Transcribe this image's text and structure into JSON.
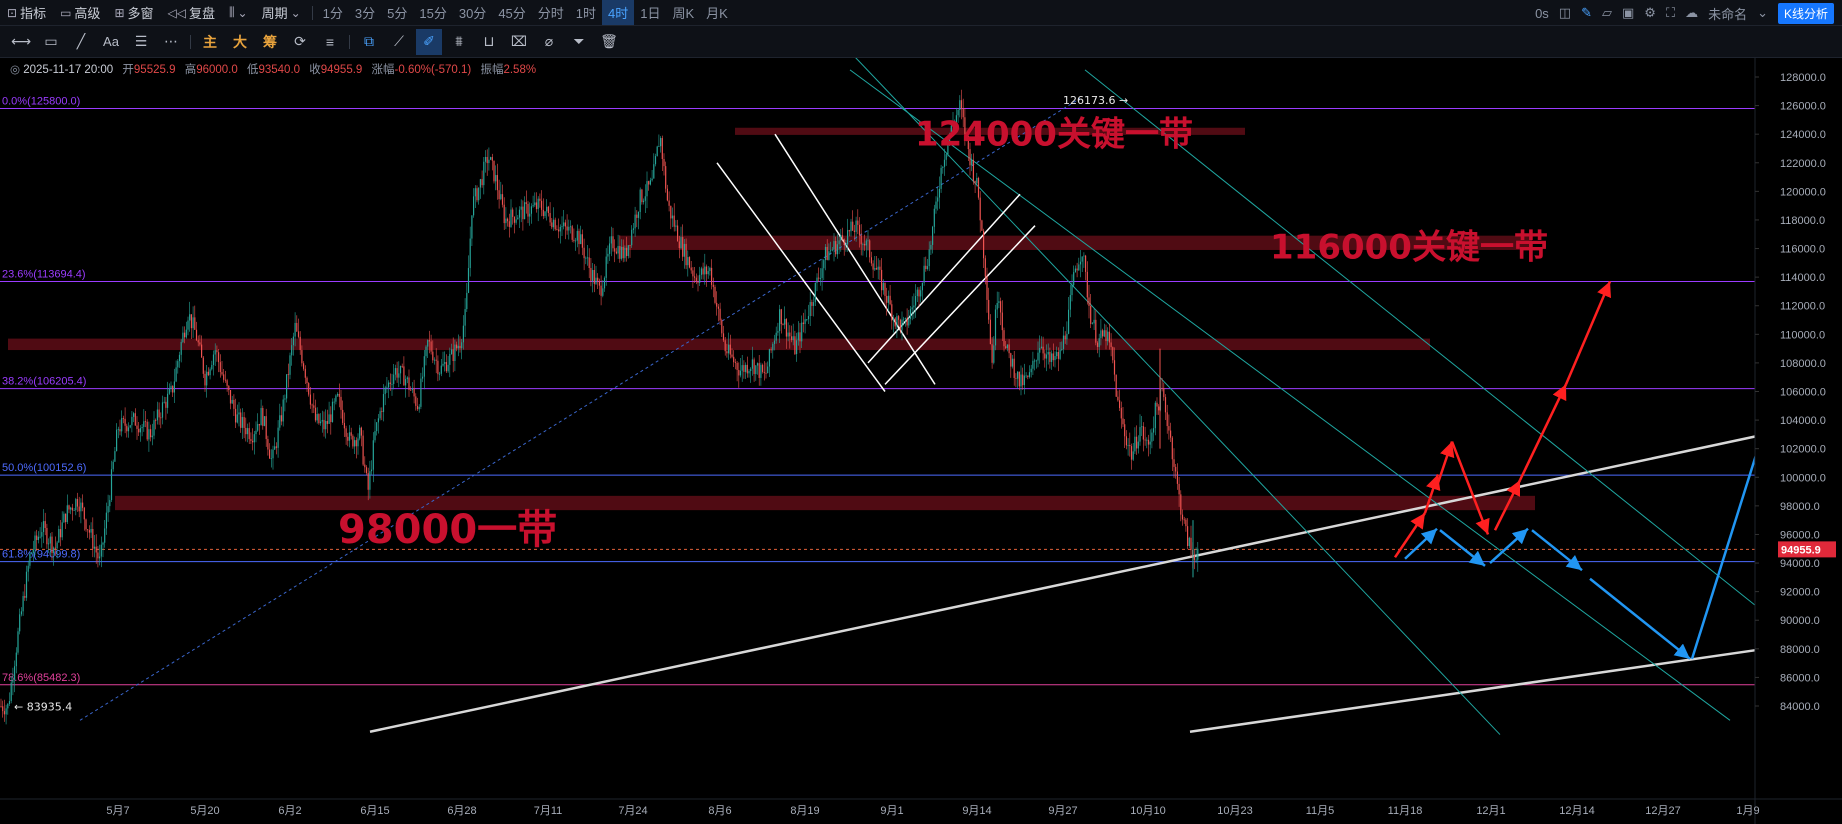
{
  "toolbar_top": {
    "left": [
      {
        "icon": "indicator-icon",
        "label": "指标"
      },
      {
        "icon": "advanced-icon",
        "label": "高级"
      },
      {
        "icon": "multiwindow-icon",
        "label": "多窗"
      },
      {
        "icon": "replay-icon",
        "label": "复盘"
      },
      {
        "icon": "candle-type-icon",
        "label": ""
      },
      {
        "icon": "",
        "label": "周期"
      }
    ],
    "periods": [
      "1分",
      "3分",
      "5分",
      "15分",
      "30分",
      "45分",
      "分时",
      "1时",
      "4时",
      "1日",
      "周K",
      "月K"
    ],
    "active_period": "4时",
    "right": {
      "timer": "0s",
      "layout_name": "未命名",
      "analysis_button": "K线分析"
    }
  },
  "toolbar_draw": {
    "labels": [
      "主",
      "大",
      "筹"
    ]
  },
  "info_bar": {
    "datetime": "2025-11-17 20:00",
    "open_label": "开",
    "open": "95525.9",
    "high_label": "高",
    "high": "96000.0",
    "low_label": "低",
    "low": "93540.0",
    "close_label": "收",
    "close": "94955.9",
    "change_label": "涨幅",
    "change": "-0.60%(-570.1)",
    "amplitude_label": "振幅",
    "amplitude": "2.58%"
  },
  "colors": {
    "background": "#000000",
    "fib_purple": "#9b3cff",
    "fib_blue": "#4d6bff",
    "fib_magenta": "#e0409a",
    "zone": "#6b0f1a",
    "bull": "#26a69a",
    "bear": "#ef5350",
    "annotation_red": "#c8102e",
    "arrow_red": "#ff2020",
    "arrow_blue": "#2196f3",
    "current_price_bg": "#e0293a"
  },
  "chart_data": {
    "type": "candlestick",
    "y_ticks": [
      84000,
      86000,
      88000,
      90000,
      92000,
      94000,
      96000,
      98000,
      100000,
      102000,
      104000,
      106000,
      108000,
      110000,
      112000,
      114000,
      116000,
      118000,
      120000,
      122000,
      124000,
      126000,
      128000
    ],
    "y_tick_labels": [
      "84000.0",
      "86000.0",
      "88000.0",
      "90000.0",
      "92000.0",
      "94000.0",
      "96000.0",
      "98000.0",
      "100000.0",
      "102000.0",
      "104000.0",
      "106000.0",
      "108000.0",
      "110000.0",
      "112000.0",
      "114000.0",
      "116000.0",
      "118000.0",
      "120000.0",
      "122000.0",
      "124000.0",
      "126000.0",
      "128000.0"
    ],
    "ylim": [
      82000,
      129500
    ],
    "x_tick_labels": [
      "5月7",
      "5月20",
      "6月2",
      "6月15",
      "6月28",
      "7月11",
      "7月24",
      "8月6",
      "8月19",
      "9月1",
      "9月14",
      "9月27",
      "10月10",
      "10月23",
      "11月5",
      "11月18",
      "12月1",
      "12月14",
      "12月27",
      "1月9"
    ],
    "price_path": [
      [
        0,
        84000
      ],
      [
        8,
        83935
      ],
      [
        18,
        89000
      ],
      [
        30,
        94500
      ],
      [
        42,
        96500
      ],
      [
        55,
        95000
      ],
      [
        66,
        97500
      ],
      [
        78,
        98500
      ],
      [
        88,
        96500
      ],
      [
        100,
        94000
      ],
      [
        108,
        98000
      ],
      [
        118,
        103500
      ],
      [
        135,
        104000
      ],
      [
        150,
        103000
      ],
      [
        163,
        105000
      ],
      [
        172,
        106000
      ],
      [
        180,
        109000
      ],
      [
        188,
        111500
      ],
      [
        196,
        110000
      ],
      [
        205,
        107000
      ],
      [
        215,
        109000
      ],
      [
        225,
        106500
      ],
      [
        238,
        104000
      ],
      [
        252,
        103000
      ],
      [
        262,
        104500
      ],
      [
        272,
        101000
      ],
      [
        282,
        104500
      ],
      [
        295,
        110500
      ],
      [
        305,
        107500
      ],
      [
        315,
        104000
      ],
      [
        325,
        103500
      ],
      [
        338,
        105500
      ],
      [
        350,
        102500
      ],
      [
        360,
        103000
      ],
      [
        368,
        99000
      ],
      [
        375,
        103000
      ],
      [
        385,
        106000
      ],
      [
        395,
        107500
      ],
      [
        405,
        107000
      ],
      [
        418,
        105000
      ],
      [
        428,
        109500
      ],
      [
        440,
        107500
      ],
      [
        452,
        108500
      ],
      [
        460,
        109500
      ],
      [
        466,
        111500
      ],
      [
        472,
        119000
      ],
      [
        480,
        120500
      ],
      [
        488,
        122500
      ],
      [
        495,
        121000
      ],
      [
        505,
        118000
      ],
      [
        520,
        118500
      ],
      [
        540,
        119000
      ],
      [
        560,
        117500
      ],
      [
        578,
        117000
      ],
      [
        590,
        114500
      ],
      [
        600,
        113000
      ],
      [
        612,
        116500
      ],
      [
        625,
        115500
      ],
      [
        640,
        119500
      ],
      [
        652,
        120500
      ],
      [
        660,
        124000
      ],
      [
        668,
        119000
      ],
      [
        680,
        116500
      ],
      [
        695,
        114000
      ],
      [
        710,
        114500
      ],
      [
        725,
        109000
      ],
      [
        740,
        107500
      ],
      [
        752,
        108000
      ],
      [
        765,
        107000
      ],
      [
        780,
        111500
      ],
      [
        795,
        109000
      ],
      [
        810,
        112000
      ],
      [
        825,
        115500
      ],
      [
        840,
        116500
      ],
      [
        855,
        117500
      ],
      [
        868,
        116000
      ],
      [
        882,
        113500
      ],
      [
        895,
        111000
      ],
      [
        905,
        110500
      ],
      [
        918,
        113000
      ],
      [
        930,
        116000
      ],
      [
        942,
        122000
      ],
      [
        952,
        124500
      ],
      [
        960,
        126000
      ],
      [
        968,
        123000
      ],
      [
        978,
        120000
      ],
      [
        986,
        114000
      ],
      [
        992,
        108000
      ],
      [
        998,
        113500
      ],
      [
        1005,
        109000
      ],
      [
        1012,
        108000
      ],
      [
        1020,
        106500
      ],
      [
        1030,
        107000
      ],
      [
        1040,
        109500
      ],
      [
        1050,
        108000
      ],
      [
        1060,
        108500
      ],
      [
        1068,
        111000
      ],
      [
        1075,
        114500
      ],
      [
        1082,
        116000
      ],
      [
        1090,
        111500
      ],
      [
        1098,
        109500
      ],
      [
        1106,
        110000
      ],
      [
        1112,
        108500
      ],
      [
        1118,
        105000
      ],
      [
        1125,
        103000
      ],
      [
        1132,
        101500
      ],
      [
        1140,
        103500
      ],
      [
        1148,
        102000
      ],
      [
        1155,
        104500
      ],
      [
        1162,
        106000
      ],
      [
        1170,
        103000
      ],
      [
        1178,
        99000
      ],
      [
        1186,
        96000
      ],
      [
        1193,
        94500
      ],
      [
        1198,
        95000
      ]
    ],
    "annotations": {
      "key_124000": "124000关键一带",
      "key_116000": "116000关键一带",
      "key_98000": "98000一带",
      "high_label": "126173.6",
      "low_label": "83935.4",
      "current_price": "94955.9"
    },
    "fib_levels": [
      {
        "label": "0.0%(125800.0)",
        "price": 125800,
        "color": "#9b3cff"
      },
      {
        "label": "23.6%(113694.4)",
        "price": 113694.4,
        "color": "#9b3cff"
      },
      {
        "label": "38.2%(106205.4)",
        "price": 106205.4,
        "color": "#9b3cff"
      },
      {
        "label": "50.0%(100152.6)",
        "price": 100152.6,
        "color": "#4d6bff"
      },
      {
        "label": "61.8%(94099.8)",
        "price": 94099.8,
        "color": "#4d6bff"
      },
      {
        "label": "78.6%(85482.3)",
        "price": 85482.3,
        "color": "#e0409a"
      }
    ],
    "zones": [
      {
        "price_low": 123950,
        "price_high": 124450
      },
      {
        "price_low": 115900,
        "price_high": 116900
      },
      {
        "price_low": 108900,
        "price_high": 109700
      },
      {
        "price_low": 97700,
        "price_high": 98700
      }
    ],
    "grid": false
  }
}
